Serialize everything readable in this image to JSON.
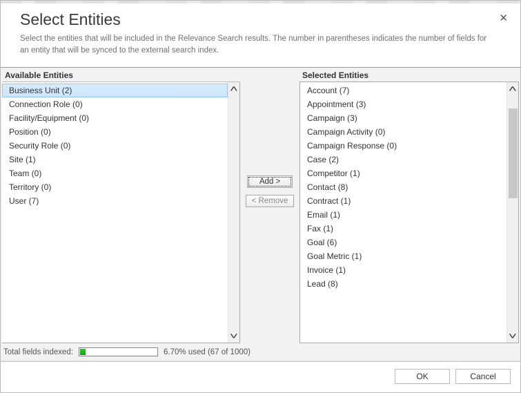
{
  "header": {
    "title": "Select Entities",
    "description": "Select the entities that will be included in the Relevance Search results. The number in parentheses indicates the number of fields for an entity that will be synced to the external search index.",
    "close": "✕"
  },
  "labels": {
    "available": "Available Entities",
    "selected": "Selected Entities"
  },
  "available": [
    {
      "name": "Business Unit",
      "count": 2,
      "selected": true
    },
    {
      "name": "Connection Role",
      "count": 0
    },
    {
      "name": "Facility/Equipment",
      "count": 0
    },
    {
      "name": "Position",
      "count": 0
    },
    {
      "name": "Security Role",
      "count": 0
    },
    {
      "name": "Site",
      "count": 1
    },
    {
      "name": "Team",
      "count": 0
    },
    {
      "name": "Territory",
      "count": 0
    },
    {
      "name": "User",
      "count": 7
    }
  ],
  "selected": [
    {
      "name": "Account",
      "count": 7
    },
    {
      "name": "Appointment",
      "count": 3
    },
    {
      "name": "Campaign",
      "count": 3
    },
    {
      "name": "Campaign Activity",
      "count": 0
    },
    {
      "name": "Campaign Response",
      "count": 0
    },
    {
      "name": "Case",
      "count": 2
    },
    {
      "name": "Competitor",
      "count": 1
    },
    {
      "name": "Contact",
      "count": 8
    },
    {
      "name": "Contract",
      "count": 1
    },
    {
      "name": "Email",
      "count": 1
    },
    {
      "name": "Fax",
      "count": 1
    },
    {
      "name": "Goal",
      "count": 6
    },
    {
      "name": "Goal Metric",
      "count": 1
    },
    {
      "name": "Invoice",
      "count": 1
    },
    {
      "name": "Lead",
      "count": 8
    }
  ],
  "buttons": {
    "add": "Add >",
    "remove": "< Remove",
    "ok": "OK",
    "cancel": "Cancel"
  },
  "status": {
    "label": "Total fields indexed:",
    "percent": 6.7,
    "text": "6.70% used (67 of 1000)"
  }
}
